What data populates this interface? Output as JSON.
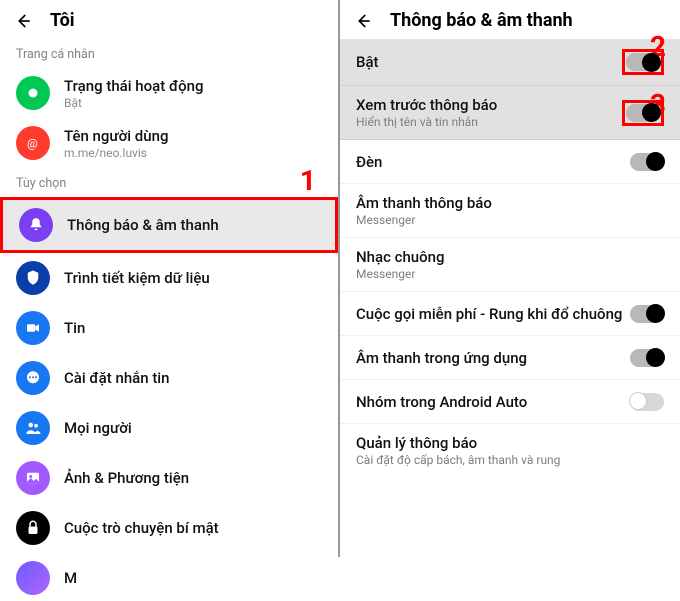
{
  "left": {
    "header_title": "Tôi",
    "section1": "Trang cá nhân",
    "section2": "Tùy chọn",
    "callout1": "1",
    "rows": {
      "activity": {
        "label": "Trạng thái hoạt động",
        "sub": "Bật"
      },
      "username": {
        "label": "Tên người dùng",
        "sub": "m.me/neo.luvis"
      },
      "notif": {
        "label": "Thông báo & âm thanh"
      },
      "data": {
        "label": "Trình tiết kiệm dữ liệu"
      },
      "tin": {
        "label": "Tin"
      },
      "msg": {
        "label": "Cài đặt nhắn tin"
      },
      "people": {
        "label": "Mọi người"
      },
      "media": {
        "label": "Ảnh & Phương tiện"
      },
      "secret": {
        "label": "Cuộc trò chuyện bí mật"
      },
      "m": {
        "label": "M"
      }
    }
  },
  "right": {
    "header_title": "Thông báo & âm thanh",
    "callout2": "2",
    "callout3": "3",
    "rows": {
      "on": {
        "label": "Bật"
      },
      "preview": {
        "label": "Xem trước thông báo",
        "sub": "Hiển thị tên và tin nhắn"
      },
      "light": {
        "label": "Đèn"
      },
      "sound": {
        "label": "Âm thanh thông báo",
        "sub": "Messenger"
      },
      "ring": {
        "label": "Nhạc chuông",
        "sub": "Messenger"
      },
      "call": {
        "label": "Cuộc gọi miễn phí - Rung khi đổ chuông"
      },
      "app": {
        "label": "Âm thanh trong ứng dụng"
      },
      "auto": {
        "label": "Nhóm trong Android Auto"
      },
      "manage": {
        "label": "Quản lý thông báo",
        "sub": "Cài đặt độ cấp bách, âm thanh và rung"
      }
    }
  }
}
